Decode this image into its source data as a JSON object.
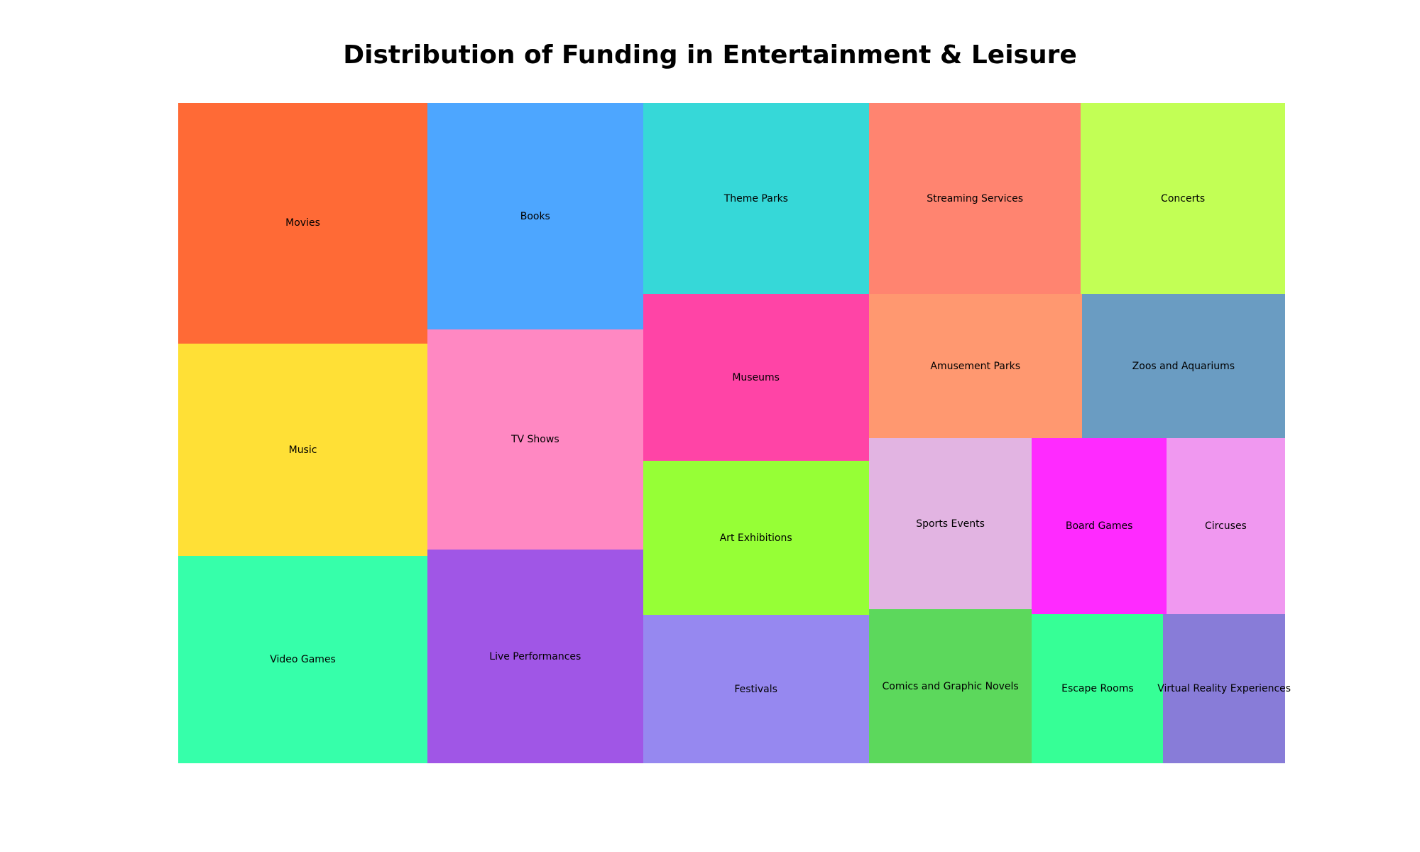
{
  "title": "Distribution of Funding in Entertainment & Leisure",
  "chart_data": {
    "type": "treemap",
    "title": "Distribution of Funding in Entertainment & Leisure",
    "items": [
      {
        "label": "Movies",
        "value": 43,
        "color": "#FF6A36"
      },
      {
        "label": "Music",
        "value": 38,
        "color": "#FFE036"
      },
      {
        "label": "Video Games",
        "value": 37,
        "color": "#36FFAA"
      },
      {
        "label": "Books",
        "value": 35,
        "color": "#4DA6FF"
      },
      {
        "label": "TV Shows",
        "value": 34,
        "color": "#FF88C2"
      },
      {
        "label": "Live Performances",
        "value": 33,
        "color": "#A056E6"
      },
      {
        "label": "Theme Parks",
        "value": 31,
        "color": "#36D8D8"
      },
      {
        "label": "Streaming Services",
        "value": 29,
        "color": "#FF8470"
      },
      {
        "label": "Concerts",
        "value": 28,
        "color": "#C2FF55"
      },
      {
        "label": "Museums",
        "value": 27,
        "color": "#FF44A6"
      },
      {
        "label": "Art Exhibitions",
        "value": 25,
        "color": "#96FF36"
      },
      {
        "label": "Festivals",
        "value": 24,
        "color": "#9688F0"
      },
      {
        "label": "Amusement Parks",
        "value": 22,
        "color": "#FF9870"
      },
      {
        "label": "Zoos and Aquariums",
        "value": 21,
        "color": "#6A9CC2"
      },
      {
        "label": "Sports Events",
        "value": 20,
        "color": "#E2B4E2"
      },
      {
        "label": "Comics and Graphic Novels",
        "value": 18,
        "color": "#5CD85C"
      },
      {
        "label": "Board Games",
        "value": 17,
        "color": "#FF2AFF"
      },
      {
        "label": "Circuses",
        "value": 15,
        "color": "#F098F0"
      },
      {
        "label": "Escape Rooms",
        "value": 14,
        "color": "#36FF96"
      },
      {
        "label": "Virtual Reality Experiences",
        "value": 13,
        "color": "#887CD8"
      }
    ]
  }
}
